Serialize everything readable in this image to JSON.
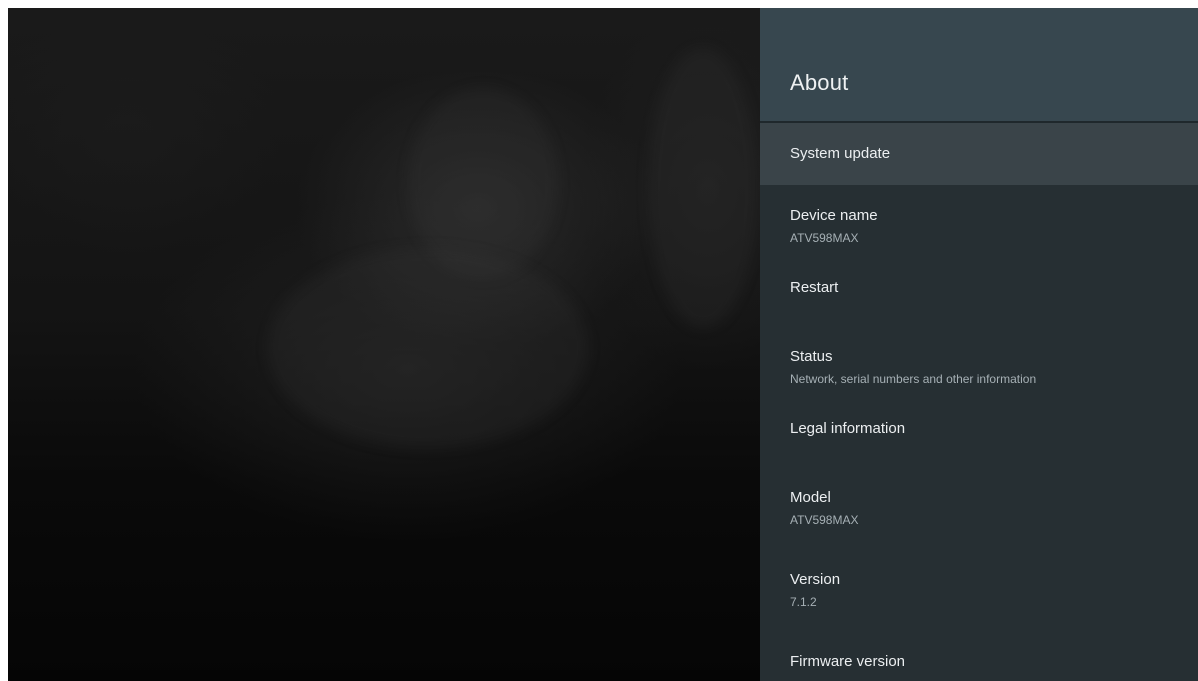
{
  "panel": {
    "title": "About"
  },
  "menu": {
    "items": [
      {
        "title": "System update",
        "subtitle": ""
      },
      {
        "title": "Device name",
        "subtitle": "ATV598MAX"
      },
      {
        "title": "Restart",
        "subtitle": ""
      },
      {
        "title": "Status",
        "subtitle": "Network, serial numbers and other information"
      },
      {
        "title": "Legal information",
        "subtitle": ""
      },
      {
        "title": "Model",
        "subtitle": "ATV598MAX"
      },
      {
        "title": "Version",
        "subtitle": "7.1.2"
      },
      {
        "title": "Firmware version",
        "subtitle": ""
      }
    ],
    "selected_index": 0
  },
  "colors": {
    "panel_background": "#262f33",
    "header_background": "#37474f",
    "selected_item_background": "#3a4449",
    "primary_text": "#eceff1",
    "secondary_text": "#a6b0b5"
  }
}
